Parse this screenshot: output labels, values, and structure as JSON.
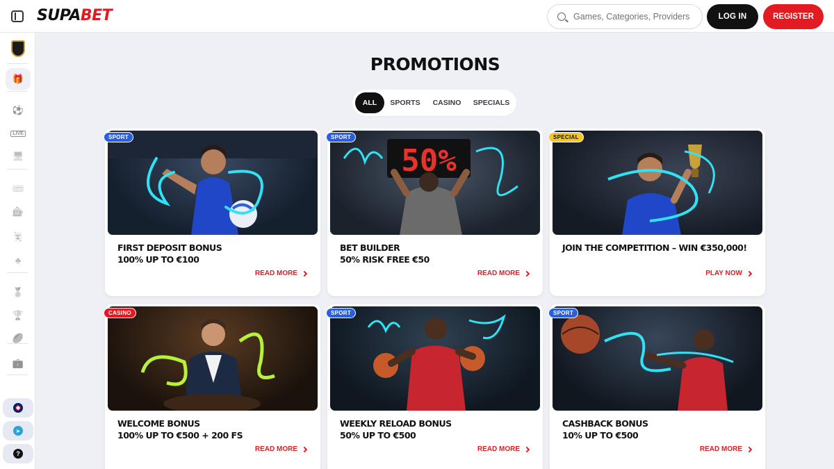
{
  "brand": {
    "logo_a": "SUPA",
    "logo_b": "BET"
  },
  "header": {
    "search_placeholder": "Games, Categories, Providers",
    "login_label": "LOG IN",
    "register_label": "REGISTER"
  },
  "sidebar": {
    "items": [
      {
        "icon": "gift-icon",
        "glyph": "🎁",
        "active": true
      },
      {
        "icon": "soccer-ball-icon",
        "glyph": "⚽"
      },
      {
        "icon": "live-icon",
        "glyph": "LIVE"
      },
      {
        "icon": "monitor-icon",
        "glyph": "🖥"
      },
      {
        "icon": "ticket-icon",
        "glyph": "🎟"
      },
      {
        "icon": "slot-machine-icon",
        "glyph": "🎰"
      },
      {
        "icon": "cards-icon",
        "glyph": "🃏"
      },
      {
        "icon": "clover-icon",
        "glyph": "♣"
      },
      {
        "icon": "award-icon",
        "glyph": "🏅"
      },
      {
        "icon": "trophy-icon",
        "glyph": "🏆"
      },
      {
        "icon": "rugby-icon",
        "glyph": "🏉"
      },
      {
        "icon": "briefcase-icon",
        "glyph": "💼"
      }
    ]
  },
  "page": {
    "title": "PROMOTIONS"
  },
  "tabs": [
    {
      "label": "ALL",
      "active": true
    },
    {
      "label": "SPORTS"
    },
    {
      "label": "CASINO"
    },
    {
      "label": "SPECIALS"
    }
  ],
  "cards": [
    {
      "badge": "SPORT",
      "badge_type": "sport",
      "title_line1": "FIRST DEPOSIT BONUS",
      "title_line2": "100% UP TO €100",
      "cta": "READ MORE"
    },
    {
      "badge": "SPORT",
      "badge_type": "sport",
      "title_line1": "BET BUILDER",
      "title_line2": "50% RISK FREE €50",
      "cta": "READ MORE",
      "image_text": "50%"
    },
    {
      "badge": "SPECIAL",
      "badge_type": "special",
      "title_line1": "JOIN THE COMPETITION – WIN €350,000!",
      "title_line2": "",
      "cta": "PLAY NOW"
    },
    {
      "badge": "CASINO",
      "badge_type": "casino",
      "title_line1": "WELCOME BONUS",
      "title_line2": "100% UP TO €500 + 200 FS",
      "cta": "READ MORE"
    },
    {
      "badge": "SPORT",
      "badge_type": "sport",
      "title_line1": "WEEKLY RELOAD BONUS",
      "title_line2": "50% UP TO €500",
      "cta": "READ MORE"
    },
    {
      "badge": "SPORT",
      "badge_type": "sport",
      "title_line1": "CASHBACK BONUS",
      "title_line2": "10% UP TO €500",
      "cta": "READ MORE"
    }
  ]
}
